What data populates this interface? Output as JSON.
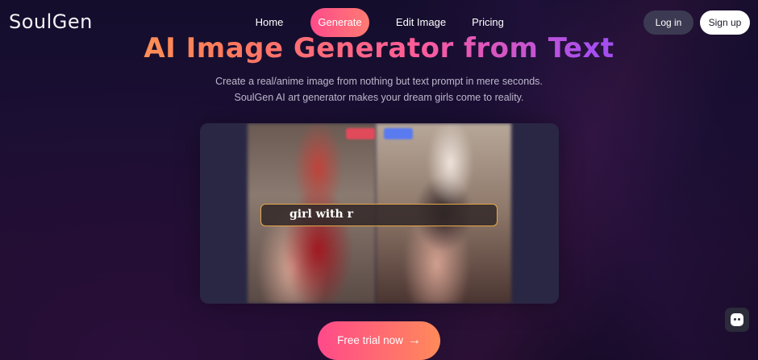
{
  "brand": {
    "logo_text": "SoulGen"
  },
  "nav": {
    "home": "Home",
    "generate": "Generate",
    "edit_image": "Edit Image",
    "pricing": "Pricing",
    "login": "Log in",
    "signup": "Sign up"
  },
  "hero": {
    "title": "AI Image Generator from Text",
    "subtitle_line1": "Create a real/anime image from nothing but text prompt in mere seconds.",
    "subtitle_line2": "SoulGen AI art generator makes your dream girls come to reality."
  },
  "showcase": {
    "prompt_text": "girl with r"
  },
  "cta": {
    "label": "Free trial now",
    "arrow_icon": "arrow-right-icon"
  },
  "chat_widget": {
    "icon": "chat-icon"
  },
  "colors": {
    "accent_pink": "#ff4b8b",
    "accent_orange": "#ff8a5a",
    "background": "#140d2c",
    "prompt_border": "#e6a84a"
  }
}
